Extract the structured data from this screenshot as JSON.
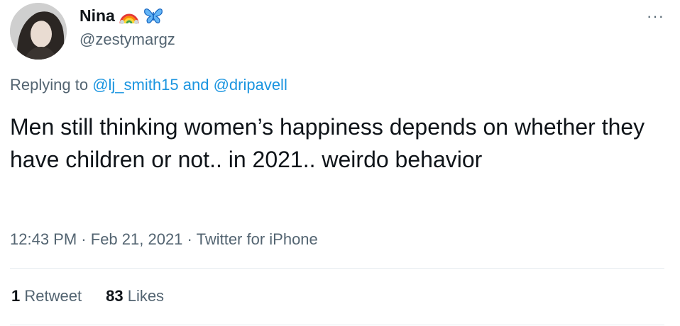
{
  "author": {
    "display_name": "Nina",
    "badges": [
      "rainbow-emoji",
      "butterfly-emoji"
    ],
    "handle": "@zestymargz"
  },
  "more_label": "···",
  "reply": {
    "prefix": "Replying to",
    "users": [
      "@lj_smith15",
      "@dripavell"
    ],
    "connector": "and"
  },
  "tweet_text": "Men still thinking women’s happiness depends on whether they have children or not.. in 2021.. weirdo behavior",
  "meta": {
    "time": "12:43 PM",
    "separator": "·",
    "date": "Feb 21, 2021",
    "source": "Twitter for iPhone"
  },
  "stats": {
    "retweets_count": "1",
    "retweets_label": "Retweet",
    "likes_count": "83",
    "likes_label": "Likes"
  },
  "colors": {
    "link": "#1b95e0",
    "secondary_text": "#536471",
    "primary_text": "#0f1419",
    "divider": "#e6ecf0"
  }
}
